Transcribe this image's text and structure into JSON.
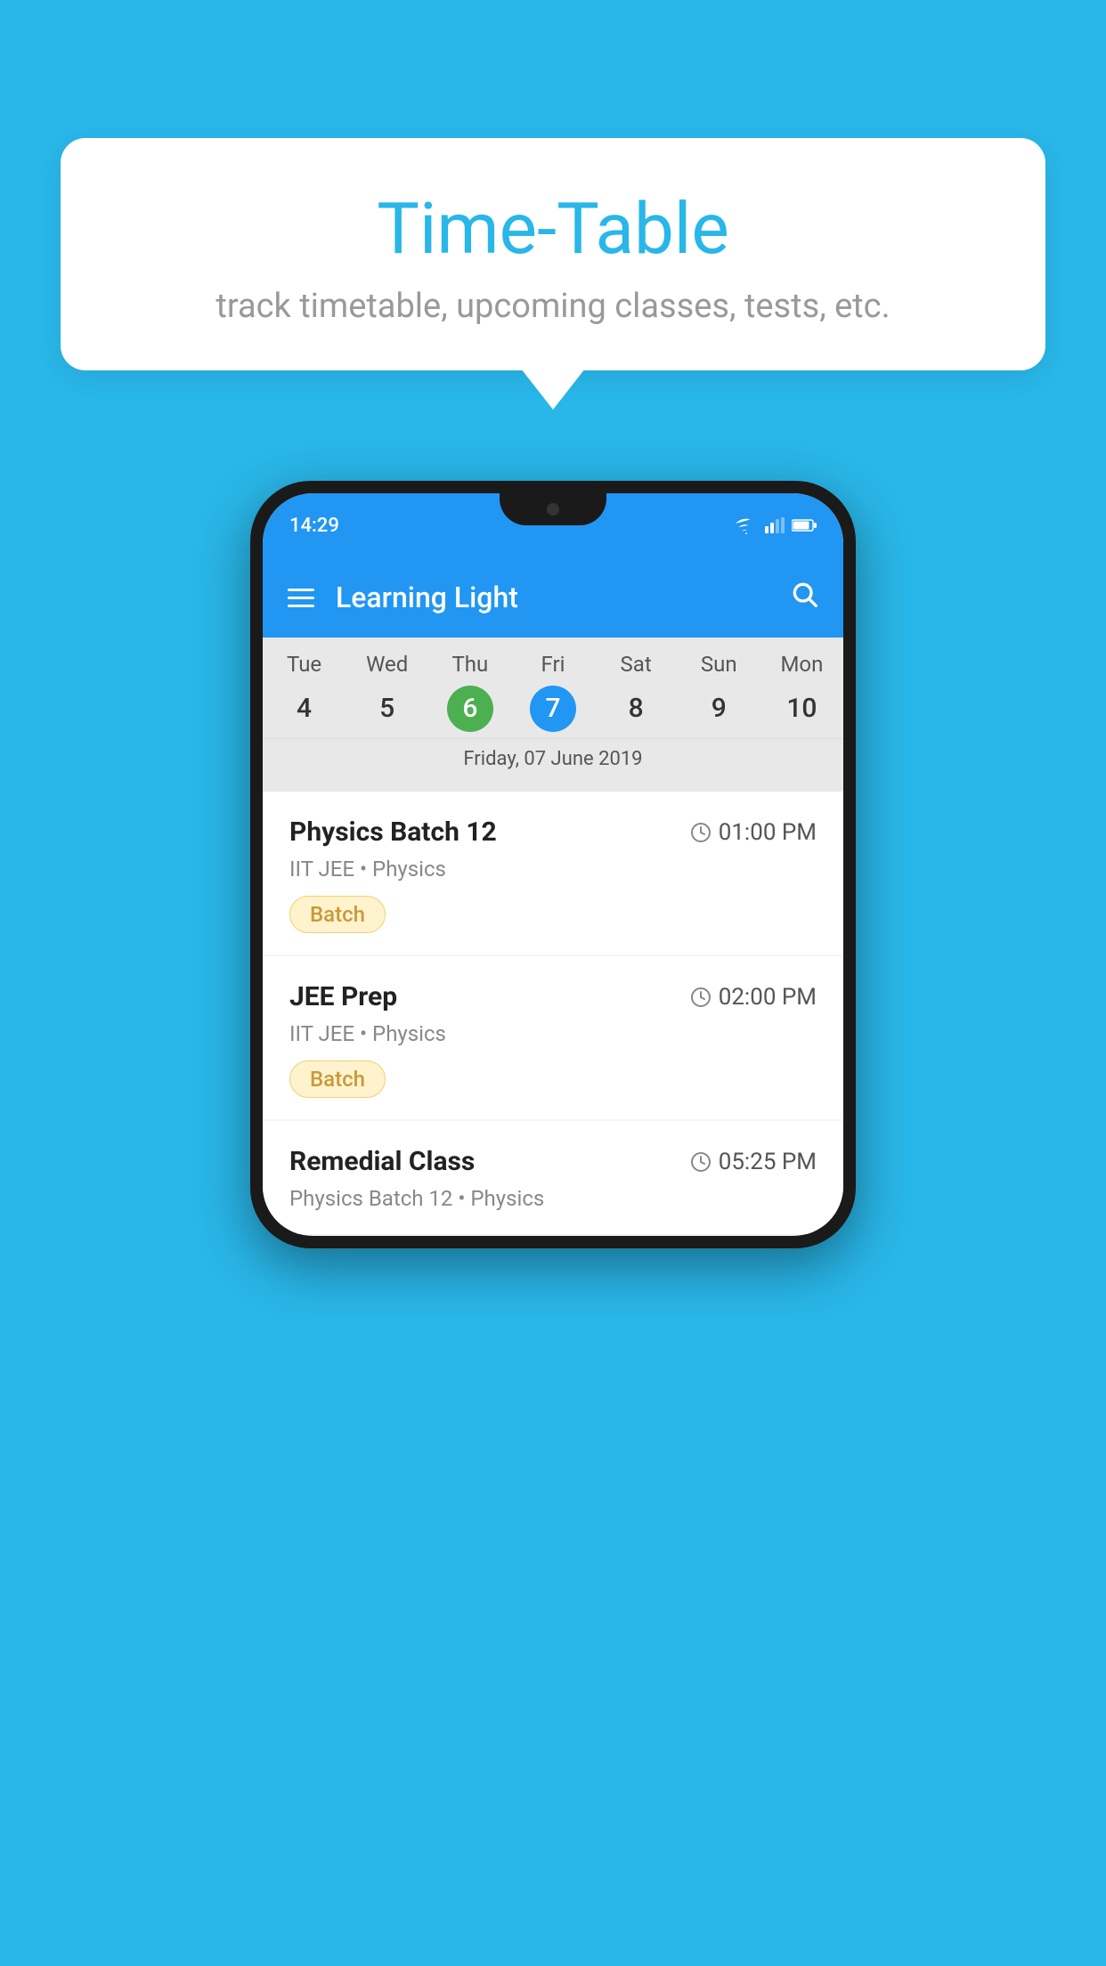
{
  "background_color": "#29b6e8",
  "speech_bubble": {
    "title": "Time-Table",
    "subtitle": "track timetable, upcoming classes, tests, etc."
  },
  "phone": {
    "status_bar": {
      "time": "14:29"
    },
    "header": {
      "title": "Learning Light"
    },
    "calendar": {
      "days": [
        "Tue",
        "Wed",
        "Thu",
        "Fri",
        "Sat",
        "Sun",
        "Mon"
      ],
      "dates": [
        "4",
        "5",
        "6",
        "7",
        "8",
        "9",
        "10"
      ],
      "today_index": 2,
      "selected_index": 3,
      "selected_date_label": "Friday, 07 June 2019"
    },
    "schedule_items": [
      {
        "title": "Physics Batch 12",
        "time": "01:00 PM",
        "subject": "IIT JEE • Physics",
        "badge": "Batch"
      },
      {
        "title": "JEE Prep",
        "time": "02:00 PM",
        "subject": "IIT JEE • Physics",
        "badge": "Batch"
      },
      {
        "title": "Remedial Class",
        "time": "05:25 PM",
        "subject": "Physics Batch 12 • Physics",
        "badge": null
      }
    ]
  }
}
